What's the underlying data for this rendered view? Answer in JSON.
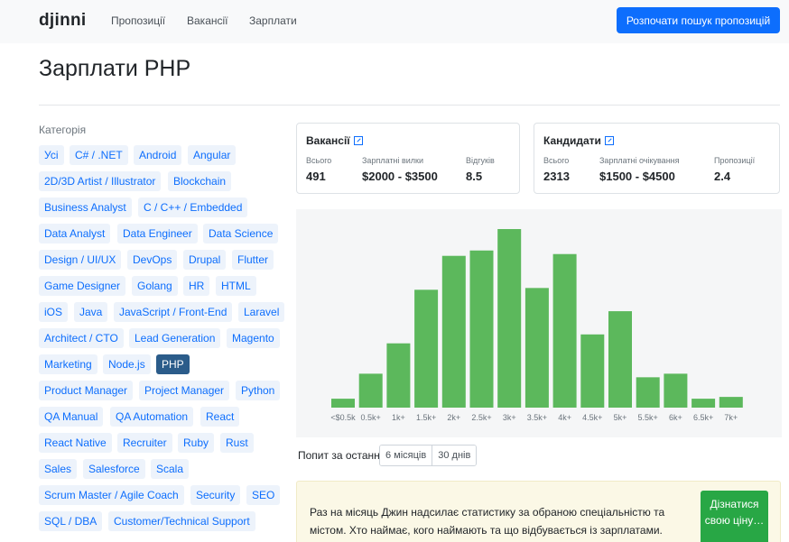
{
  "header": {
    "logo": "djinni",
    "nav": [
      "Пропозиції",
      "Вакансії",
      "Зарплати"
    ],
    "cta_label": "Розпочати пошук пропозицій"
  },
  "page": {
    "title": "Зарплати PHP"
  },
  "categories": {
    "label": "Категорія",
    "selected": "PHP",
    "items": [
      "Усі",
      "C# / .NET",
      "Android",
      "Angular",
      "2D/3D Artist / Illustrator",
      "Blockchain",
      "Business Analyst",
      "C / C++ / Embedded",
      "Data Analyst",
      "Data Engineer",
      "Data Science",
      "Design / UI/UX",
      "DevOps",
      "Drupal",
      "Flutter",
      "Game Designer",
      "Golang",
      "HR",
      "HTML",
      "iOS",
      "Java",
      "JavaScript / Front-End",
      "Laravel",
      "Architect / CTO",
      "Lead Generation",
      "Magento",
      "Marketing",
      "Node.js",
      "PHP",
      "Product Manager",
      "Project Manager",
      "Python",
      "QA Manual",
      "QA Automation",
      "React",
      "React Native",
      "Recruiter",
      "Ruby",
      "Rust",
      "Sales",
      "Salesforce",
      "Scala",
      "Scrum Master / Agile Coach",
      "Security",
      "SEO",
      "SQL / DBA",
      "Customer/Technical Support"
    ]
  },
  "vacancies": {
    "title": "Вакансії",
    "total_label": "Всього",
    "total": "491",
    "range_label": "Зарплатні вилки",
    "range": "$2000 - $3500",
    "responses_label": "Відгуків",
    "responses": "8.5"
  },
  "candidates": {
    "title": "Кандидати",
    "total_label": "Всього",
    "total": "2313",
    "range_label": "Зарплатні очікування",
    "range": "$1500 - $4500",
    "offers_label": "Пропозиції",
    "offers": "2.4"
  },
  "chart_data": {
    "type": "bar",
    "categories": [
      "<$0.5k",
      "0.5k+",
      "1k+",
      "1.5k+",
      "2k+",
      "2.5k+",
      "3k+",
      "3.5k+",
      "4k+",
      "4.5k+",
      "5k+",
      "5.5k+",
      "6k+",
      "6.5k+",
      "7k+"
    ],
    "values": [
      5,
      19,
      36,
      66,
      85,
      88,
      100,
      67,
      86,
      41,
      54,
      17,
      19,
      5,
      6
    ],
    "title": "",
    "xlabel": "",
    "ylabel": "",
    "ylim": [
      0,
      100
    ],
    "grid": false,
    "bar_color": "#5cb85c"
  },
  "period": {
    "label": "Попит за останні",
    "options": [
      "6 місяців",
      "30 днів"
    ]
  },
  "promo": {
    "text": "Раз на місяць Джин надсилає статистику за обраною спеціальністю та містом. Хто наймає, кого наймають та що відбувається із зарплатами.",
    "button": "Дізнатися свою ціну…"
  },
  "colors": {
    "primary": "#0d6efd",
    "selected_tag": "#2b5c8a",
    "bar": "#5cb85c",
    "promo_button": "#28a745"
  }
}
